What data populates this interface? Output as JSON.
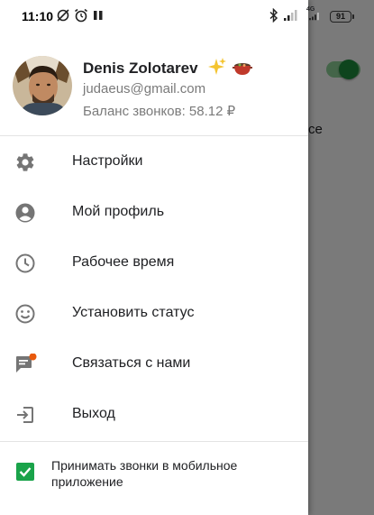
{
  "status_bar": {
    "time": "11:10",
    "battery": "91",
    "network": "4G"
  },
  "background": {
    "partial_text": "се",
    "toggle_state": "on"
  },
  "profile": {
    "name": "Denis Zolotarev",
    "email": "judaeus@gmail.com",
    "balance": "Баланс звонков: 58.12 ₽"
  },
  "menu": [
    {
      "label": "Настройки",
      "icon": "gear-icon"
    },
    {
      "label": "Мой профиль",
      "icon": "account-icon"
    },
    {
      "label": "Рабочее время",
      "icon": "clock-icon"
    },
    {
      "label": "Установить статус",
      "icon": "smiley-icon"
    },
    {
      "label": "Связаться с нами",
      "icon": "chat-icon",
      "badge": true
    },
    {
      "label": "Выход",
      "icon": "logout-icon"
    }
  ],
  "mobile_calls": {
    "label": "Принимать звонки в мобильное приложение",
    "checked": true
  },
  "colors": {
    "accent_green": "#1aa34a",
    "badge_orange": "#e8590c",
    "icon_grey": "#757575",
    "toggle_green": "#1e8e3e"
  }
}
